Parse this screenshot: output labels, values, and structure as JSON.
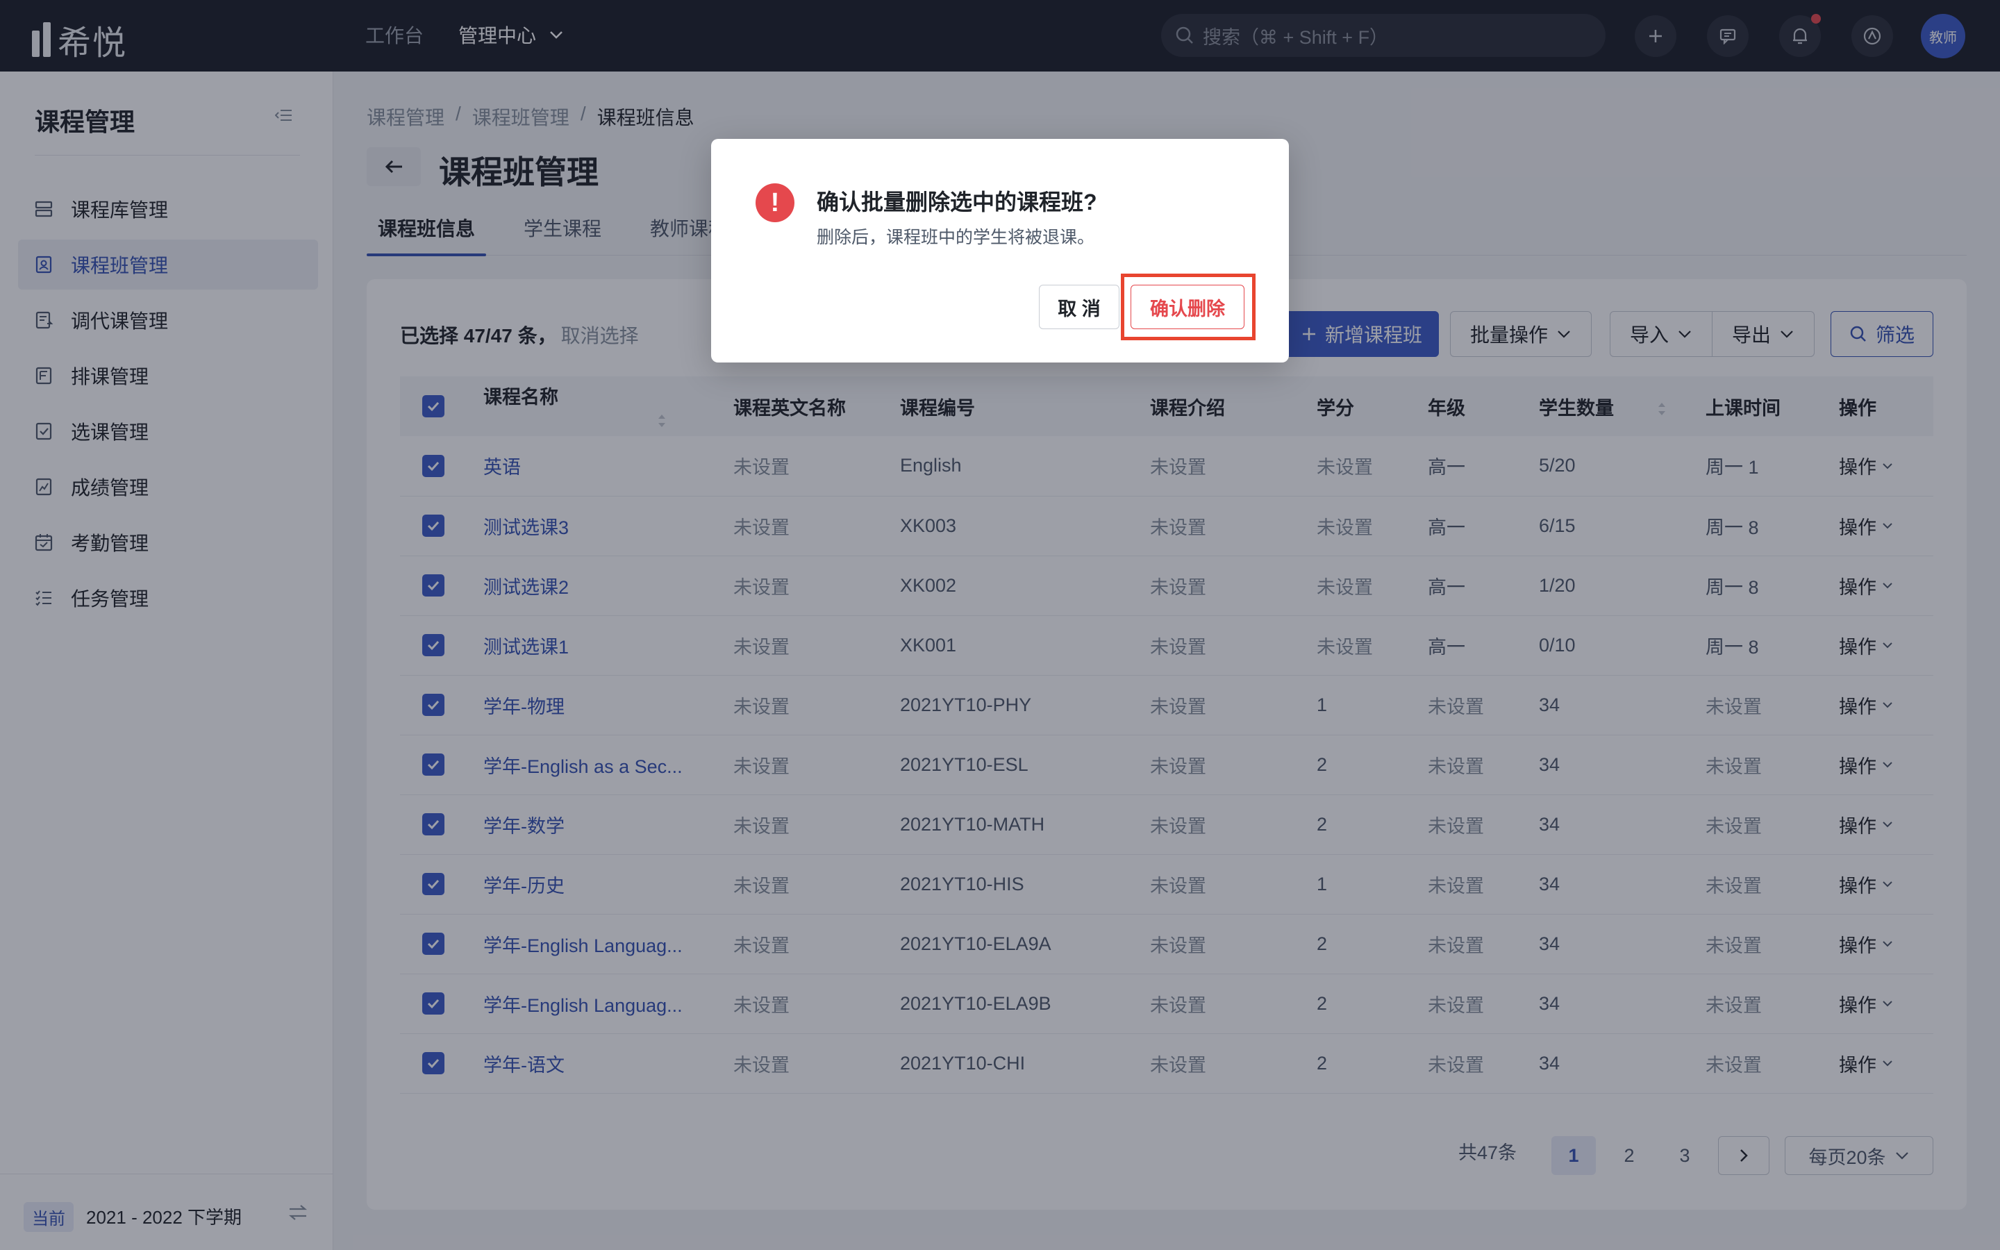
{
  "topbar": {
    "logo_text": "希悦",
    "nav": [
      {
        "label": "工作台"
      },
      {
        "label": "管理中心"
      }
    ],
    "search_placeholder": "搜索（⌘ + Shift + F）",
    "avatar_label": "教师"
  },
  "sidebar": {
    "title": "课程管理",
    "items": [
      {
        "label": "课程库管理",
        "icon": "library-icon"
      },
      {
        "label": "课程班管理",
        "icon": "class-icon"
      },
      {
        "label": "调代课管理",
        "icon": "substitute-icon"
      },
      {
        "label": "排课管理",
        "icon": "schedule-icon"
      },
      {
        "label": "选课管理",
        "icon": "selection-icon"
      },
      {
        "label": "成绩管理",
        "icon": "grade-icon"
      },
      {
        "label": "考勤管理",
        "icon": "attendance-icon"
      },
      {
        "label": "任务管理",
        "icon": "task-icon"
      }
    ],
    "active_index": 1,
    "term_badge": "当前",
    "term": "2021 - 2022 下学期"
  },
  "breadcrumb": [
    "课程管理",
    "课程班管理",
    "课程班信息"
  ],
  "page_title": "课程班管理",
  "tabs": [
    "课程班信息",
    "学生课程",
    "教师课程"
  ],
  "toolbar": {
    "selection_text": "已选择 47/47 条，",
    "cancel_selection": "取消选择",
    "add_label": "新增课程班",
    "batch_label": "批量操作",
    "import_label": "导入",
    "export_label": "导出",
    "filter_label": "筛选"
  },
  "table": {
    "headers": [
      "课程名称",
      "课程英文名称",
      "课程编号",
      "课程介绍",
      "学分",
      "年级",
      "学生数量",
      "上课时间",
      "操作"
    ],
    "rows": [
      [
        "英语",
        "未设置",
        "English",
        "未设置",
        "未设置",
        "高一",
        "5/20",
        "周一 1",
        "操作"
      ],
      [
        "测试选课3",
        "未设置",
        "XK003",
        "未设置",
        "未设置",
        "高一",
        "6/15",
        "周一 8",
        "操作"
      ],
      [
        "测试选课2",
        "未设置",
        "XK002",
        "未设置",
        "未设置",
        "高一",
        "1/20",
        "周一 8",
        "操作"
      ],
      [
        "测试选课1",
        "未设置",
        "XK001",
        "未设置",
        "未设置",
        "高一",
        "0/10",
        "周一 8",
        "操作"
      ],
      [
        "学年-物理",
        "未设置",
        "2021YT10-PHY",
        "未设置",
        "1",
        "未设置",
        "34",
        "未设置",
        "操作"
      ],
      [
        "学年-English as a Sec...",
        "未设置",
        "2021YT10-ESL",
        "未设置",
        "2",
        "未设置",
        "34",
        "未设置",
        "操作"
      ],
      [
        "学年-数学",
        "未设置",
        "2021YT10-MATH",
        "未设置",
        "2",
        "未设置",
        "34",
        "未设置",
        "操作"
      ],
      [
        "学年-历史",
        "未设置",
        "2021YT10-HIS",
        "未设置",
        "1",
        "未设置",
        "34",
        "未设置",
        "操作"
      ],
      [
        "学年-English Languag...",
        "未设置",
        "2021YT10-ELA9A",
        "未设置",
        "2",
        "未设置",
        "34",
        "未设置",
        "操作"
      ],
      [
        "学年-English Languag...",
        "未设置",
        "2021YT10-ELA9B",
        "未设置",
        "2",
        "未设置",
        "34",
        "未设置",
        "操作"
      ],
      [
        "学年-语文",
        "未设置",
        "2021YT10-CHI",
        "未设置",
        "2",
        "未设置",
        "34",
        "未设置",
        "操作"
      ]
    ]
  },
  "pagination": {
    "total": "共47条",
    "pages": [
      "1",
      "2",
      "3"
    ],
    "current": "1",
    "page_size": "每页20条"
  },
  "modal": {
    "title": "确认批量删除选中的课程班?",
    "description": "删除后，课程班中的学生将被退课。",
    "cancel_label": "取 消",
    "confirm_label": "确认删除"
  },
  "colors": {
    "accent": "#3c5bc7",
    "danger": "#e5484d",
    "highlight": "#e8452f",
    "topbar": "#1b1e27"
  }
}
